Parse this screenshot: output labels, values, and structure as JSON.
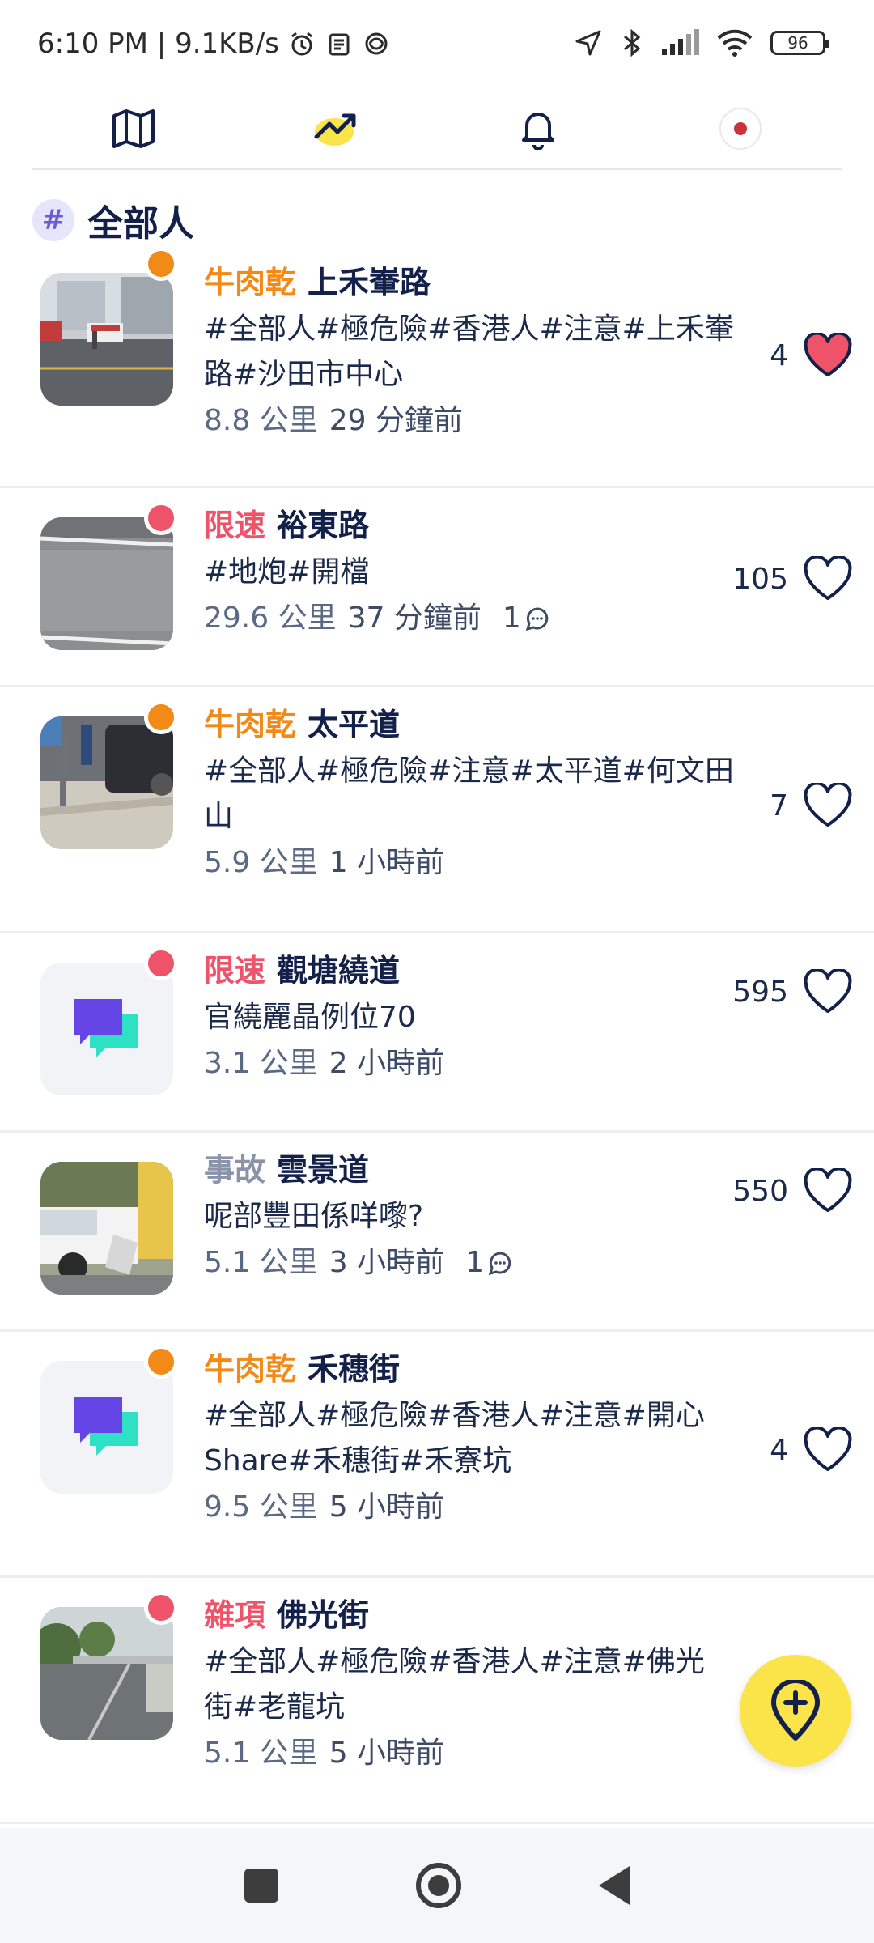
{
  "status_bar": {
    "time_speed": "6:10 PM | 9.1KB/s",
    "battery": "96"
  },
  "channel": {
    "hash": "#",
    "title": "全部人"
  },
  "colors": {
    "orange": "#f28a17",
    "red": "#ef5369",
    "gray": "#8a93a8",
    "navy": "#13204a",
    "fab": "#fbe34a"
  },
  "feed": [
    {
      "category": "牛肉乾",
      "place": "上禾輋路",
      "desc_line1": "#全部人#極危險#香港人#注意#上禾輋",
      "desc_line2": "路#沙田市中心",
      "distance": "8.8 公里",
      "time": "29 分鐘前",
      "comments": "",
      "likes": "4",
      "liked": true
    },
    {
      "category": "限速",
      "place": "裕東路",
      "desc_line1": "#地炮#開檔",
      "desc_line2": "",
      "distance": "29.6 公里",
      "time": "37 分鐘前",
      "comments": "1",
      "likes": "105",
      "liked": false
    },
    {
      "category": "牛肉乾",
      "place": "太平道",
      "desc_line1": "#全部人#極危險#注意#太平道#何文田",
      "desc_line2": "山",
      "distance": "5.9 公里",
      "time": "1 小時前",
      "comments": "",
      "likes": "7",
      "liked": false
    },
    {
      "category": "限速",
      "place": "觀塘繞道",
      "desc_line1": "官繞麗晶例位70",
      "desc_line2": "",
      "distance": "3.1 公里",
      "time": "2 小時前",
      "comments": "",
      "likes": "595",
      "liked": false
    },
    {
      "category": "事故",
      "place": "雲景道",
      "desc_line1": "呢部豐田係咩嚟?",
      "desc_line2": "",
      "distance": "5.1 公里",
      "time": "3 小時前",
      "comments": "1",
      "likes": "550",
      "liked": false
    },
    {
      "category": "牛肉乾",
      "place": "禾穗街",
      "desc_line1": "#全部人#極危險#香港人#注意#開心",
      "desc_line2": "Share#禾穗街#禾寮坑",
      "distance": "9.5 公里",
      "time": "5 小時前",
      "comments": "",
      "likes": "4",
      "liked": false
    },
    {
      "category": "雜項",
      "place": "佛光街",
      "desc_line1": "#全部人#極危險#香港人#注意#佛光",
      "desc_line2": "街#老龍坑",
      "distance": "5.1 公里",
      "time": "5 小時前",
      "comments": "",
      "likes": "",
      "liked": false
    }
  ]
}
